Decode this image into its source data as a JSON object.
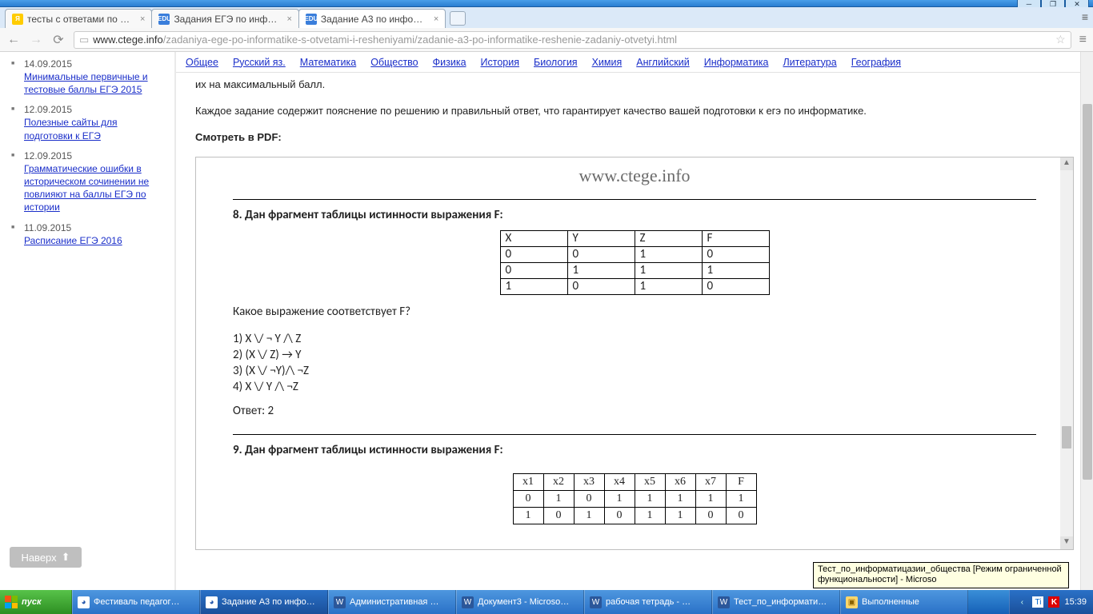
{
  "window": {
    "min": "─",
    "max": "❐",
    "close": "✕"
  },
  "tabs": [
    {
      "fav": "Я",
      "favbg": "#ffcc00",
      "title": "тесты с ответами по инфо"
    },
    {
      "fav": "EDU",
      "favbg": "#3a7edb",
      "title": "Задания ЕГЭ по информати"
    },
    {
      "fav": "EDU",
      "favbg": "#3a7edb",
      "title": "Задание А3 по информатик",
      "active": true
    }
  ],
  "url_host": "www.ctege.info",
  "url_path": "/zadaniya-ege-po-informatike-s-otvetami-i-resheniyami/zadanie-a3-po-informatike-reshenie-zadaniy-otvetyi.html",
  "subnav": [
    "Общее",
    "Русский яз.",
    "Математика",
    "Общество",
    "Физика",
    "История",
    "Биология",
    "Химия",
    "Английский",
    "Информатика",
    "Литература",
    "География"
  ],
  "sidebar": [
    {
      "date": "14.09.2015",
      "text": "Минимальные первичные и тестовые баллы ЕГЭ 2015"
    },
    {
      "date": "12.09.2015",
      "text": "Полезные сайты для подготовки к ЕГЭ"
    },
    {
      "date": "12.09.2015",
      "text": "Грамматические ошибки в историческом сочинении не повлияют на баллы ЕГЭ по истории"
    },
    {
      "date": "11.09.2015",
      "text": "Расписание ЕГЭ 2016"
    }
  ],
  "to_top": "Наверх",
  "body_line1": "их на максимальный балл.",
  "body_para": "Каждое задание содержит пояснение по решению и правильный ответ, что гарантирует качество вашей подготовки к егэ по информатике.",
  "pdf_lead": "Смотреть в PDF:",
  "pdf_brand": "www.ctege.info",
  "task8_h": "8. Дан фрагмент таблицы истинности выражения F:",
  "task8_cols": [
    "X",
    "Y",
    "Z",
    "F"
  ],
  "task8_rows": [
    [
      "0",
      "0",
      "1",
      "0"
    ],
    [
      "0",
      "1",
      "1",
      "1"
    ],
    [
      "1",
      "0",
      "1",
      "0"
    ]
  ],
  "task8_q": "Какое выражение соответствует F?",
  "task8_opts": [
    "1) X \\/ ¬ Y /\\ Z",
    "2) (X \\/ Z) → Y",
    "3) (X \\/ ¬Y)/\\ ¬Z",
    "4) X \\/ Y /\\ ¬Z"
  ],
  "task8_ans": "Ответ: 2",
  "task9_h": "9. Дан фрагмент таблицы истинности выражения F:",
  "task9_cols": [
    "x1",
    "x2",
    "x3",
    "x4",
    "x5",
    "x6",
    "x7",
    "F"
  ],
  "task9_rows": [
    [
      "0",
      "1",
      "0",
      "1",
      "1",
      "1",
      "1",
      "1"
    ],
    [
      "1",
      "0",
      "1",
      "0",
      "1",
      "1",
      "0",
      "0"
    ]
  ],
  "tooltip": "Тест_по_информатицазии_общества [Режим ограниченной функциональности] - Microso",
  "taskbar": {
    "start": "пуск",
    "items": [
      {
        "icon": "chrome",
        "label": "Фестиваль педагог…"
      },
      {
        "icon": "chrome",
        "label": "Задание А3 по инфо…",
        "active": true
      },
      {
        "icon": "word",
        "label": "Административная …"
      },
      {
        "icon": "word",
        "label": "Документ3 - Microso…"
      },
      {
        "icon": "word",
        "label": "рабочая тетрадь - …"
      },
      {
        "icon": "word",
        "label": "Тест_по_информати…"
      },
      {
        "icon": "folder",
        "label": "Выполненные"
      }
    ],
    "clock": "15:39"
  }
}
